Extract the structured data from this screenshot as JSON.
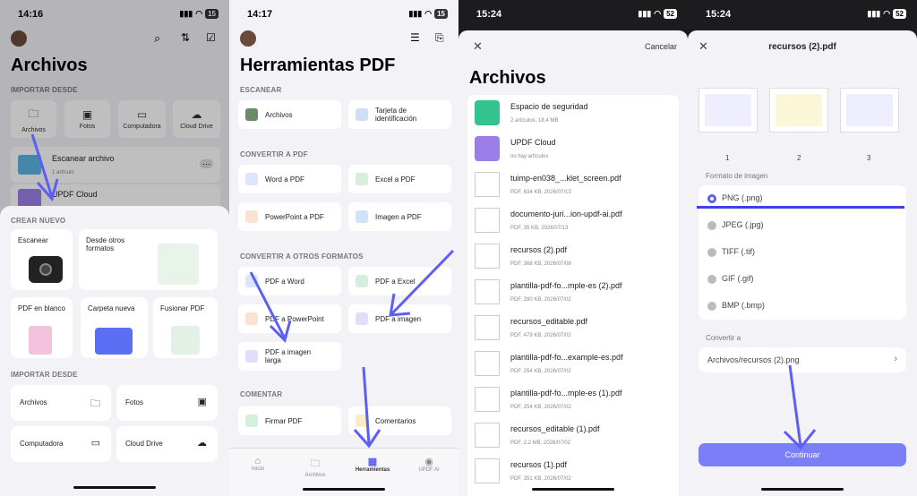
{
  "p1": {
    "time": "14:16",
    "battery": "15",
    "title": "Archivos",
    "import_label": "IMPORTAR DESDE",
    "import_tiles": [
      "Archivos",
      "Fotos",
      "Computadora",
      "Cloud Drive"
    ],
    "list": [
      {
        "name": "Escanear archivo",
        "meta": "1 artículo"
      },
      {
        "name": "UPDF Cloud"
      }
    ],
    "create_label": "CREAR NUEVO",
    "create": [
      "Escanear",
      "Desde otros formatos",
      "PDF en blanco",
      "Carpeta nueva",
      "Fusionar PDF"
    ],
    "import2_label": "IMPORTAR DESDE",
    "import2": [
      "Archivos",
      "Fotos",
      "Computadora",
      "Cloud Drive"
    ]
  },
  "p2": {
    "time": "14:17",
    "battery": "15",
    "title": "Herramientas PDF",
    "scan_label": "ESCANEAR",
    "scan": [
      "Archivos",
      "Tarjeta de identificación"
    ],
    "conv_label": "CONVERTIR A PDF",
    "conv": [
      "Word a PDF",
      "Excel a PDF",
      "PowerPoint a PDF",
      "Imagen a PDF"
    ],
    "other_label": "CONVERTIR A OTROS FORMATOS",
    "other": [
      "PDF a Word",
      "PDF a Excel",
      "PDF a PowerPoint",
      "PDF a imagen",
      "PDF a imagen larga"
    ],
    "comment_label": "COMENTAR",
    "comment": [
      "Firmar PDF",
      "Comentarios"
    ],
    "tabs": [
      "Inicio",
      "Archivos",
      "Herramientas",
      "UPDF AI"
    ]
  },
  "p3": {
    "time": "15:24",
    "battery": "52",
    "cancel": "Cancelar",
    "title": "Archivos",
    "folders": [
      {
        "name": "Espacio de seguridad",
        "meta": "2 artículos, 18.4 MB",
        "color": "#34c38f"
      },
      {
        "name": "UPDF Cloud",
        "meta": "no hay artículos",
        "color": "#9b7fe6"
      }
    ],
    "files": [
      {
        "name": "tuimp-en038_...klet_screen.pdf",
        "meta": "PDF, 634 KB, 2026/07/13"
      },
      {
        "name": "documento-juri...ion-updf-ai.pdf",
        "meta": "PDF, 35 KB, 2026/07/13"
      },
      {
        "name": "recursos (2).pdf",
        "meta": "PDF, 368 KB, 2026/07/08"
      },
      {
        "name": "plantilla-pdf-fo...mple-es (2).pdf",
        "meta": "PDF, 280 KB, 2026/07/02"
      },
      {
        "name": "recursos_editable.pdf",
        "meta": "PDF, 479 KB, 2026/07/02"
      },
      {
        "name": "plantilla-pdf-fo...example-es.pdf",
        "meta": "PDF, 254 KB, 2026/07/02"
      },
      {
        "name": "plantilla-pdf-fo...mple-es (1).pdf",
        "meta": "PDF, 254 KB, 2026/07/02"
      },
      {
        "name": "recursos_editable (1).pdf",
        "meta": "PDF, 2.2 MB, 2026/07/02"
      },
      {
        "name": "recursos (1).pdf",
        "meta": "PDF, 351 KB, 2026/07/02"
      }
    ]
  },
  "p4": {
    "time": "15:24",
    "battery": "52",
    "title": "recursos (2).pdf",
    "pages": [
      "1",
      "2",
      "3"
    ],
    "format_label": "Formato de imagen",
    "formats": [
      "PNG (.png)",
      "JPEG (.jpg)",
      "TIFF (.tif)",
      "GIF (.gif)",
      "BMP (.bmp)"
    ],
    "convert_label": "Convertir a",
    "path": "Archivos/recursos (2).png",
    "continue": "Continuar"
  },
  "colors": {
    "accent": "#5b5ff5",
    "button": "#7b7ff7"
  }
}
